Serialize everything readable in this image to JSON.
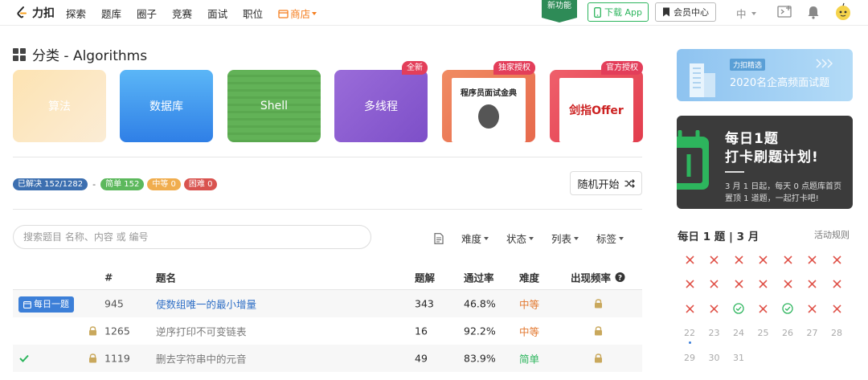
{
  "nav": {
    "logo_text": "力扣",
    "items": [
      "探索",
      "题库",
      "圈子",
      "竞赛",
      "面试",
      "职位"
    ],
    "shop": "商店",
    "new_feature": "新功能",
    "download": "下载 App",
    "vip": "会员中心",
    "lang": "中"
  },
  "page": {
    "heading": "分类 - Algorithms"
  },
  "categories": [
    {
      "label": "算法",
      "badge": ""
    },
    {
      "label": "数据库",
      "badge": ""
    },
    {
      "label": "Shell",
      "badge": ""
    },
    {
      "label": "多线程",
      "badge": "全新"
    },
    {
      "label": "",
      "badge": "独家授权",
      "book": "程序员面试金典"
    },
    {
      "label": "",
      "badge": "官方授权",
      "book": "剑指Offer"
    }
  ],
  "stats": {
    "solved": "已解决 152/1282",
    "easy": "简单 152",
    "medium": "中等 0",
    "hard": "困难 0",
    "random": "随机开始"
  },
  "search": {
    "placeholder": "搜索题目 名称、内容 或 编号"
  },
  "filters": [
    "难度",
    "状态",
    "列表",
    "标签"
  ],
  "table": {
    "headers": {
      "num": "#",
      "title": "题名",
      "solutions": "题解",
      "rate": "通过率",
      "difficulty": "难度",
      "frequency": "出现频率"
    },
    "daily_tag": "每日一题",
    "rows": [
      {
        "num": "945",
        "title": "使数组唯一的最小增量",
        "solutions": "343",
        "rate": "46.8%",
        "difficulty": "中等",
        "locked": false,
        "solved": false,
        "daily": true
      },
      {
        "num": "1265",
        "title": "逆序打印不可变链表",
        "solutions": "16",
        "rate": "92.2%",
        "difficulty": "中等",
        "locked": true,
        "solved": false,
        "daily": false
      },
      {
        "num": "1119",
        "title": "删去字符串中的元音",
        "solutions": "49",
        "rate": "83.9%",
        "difficulty": "简单",
        "locked": true,
        "solved": true,
        "daily": false
      }
    ]
  },
  "sidebar": {
    "banner1_tag": "力扣精选",
    "banner1_title": "2020名企高频面试题",
    "banner2_line1": "每日1题",
    "banner2_line2": "打卡刷题计划!",
    "banner2_desc1": "3 月 1 日起，每天 0 点题库首页",
    "banner2_desc2": "置顶 1 道题，一起打卡吧!",
    "calendar_title": "每日 1 题 | 3 月",
    "calendar_rules": "活动规则",
    "calendar": [
      [
        "x",
        "x",
        "x",
        "x",
        "x",
        "x",
        "x"
      ],
      [
        "x",
        "x",
        "x",
        "x",
        "x",
        "x",
        "x"
      ],
      [
        "x",
        "x",
        "v",
        "x",
        "v",
        "x",
        "x"
      ],
      [
        "22",
        "23",
        "24",
        "25",
        "26",
        "27",
        "28"
      ],
      [
        "29",
        "30",
        "31",
        "",
        "",
        "",
        ""
      ]
    ]
  },
  "colors": {
    "accent_blue": "#3c7fd8",
    "green": "#2db55d",
    "orange": "#e3782f",
    "red": "#e33e5a"
  }
}
